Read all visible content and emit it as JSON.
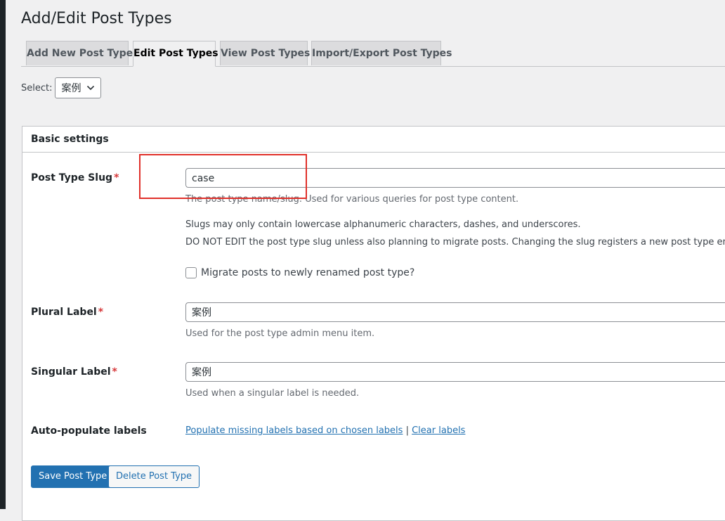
{
  "page": {
    "title": "Add/Edit Post Types"
  },
  "tabs": [
    {
      "label": "Add New Post Type",
      "active": false
    },
    {
      "label": "Edit Post Types",
      "active": true
    },
    {
      "label": "View Post Types",
      "active": false
    },
    {
      "label": "Import/Export Post Types",
      "active": false
    }
  ],
  "selector": {
    "label": "Select:",
    "value": "案例",
    "icon": "chevron-down-icon"
  },
  "panel": {
    "title": "Basic settings",
    "required_marker": "*",
    "slug": {
      "label": "Post Type Slug",
      "value": "case",
      "desc_1": "The post type name/slug. Used for various queries for post type content.",
      "desc_2": "Slugs may only contain lowercase alphanumeric characters, dashes, and underscores.",
      "desc_3": "DO NOT EDIT the post type slug unless also planning to migrate posts. Changing the slug registers a new post type entry.",
      "migrate_label": "Migrate posts to newly renamed post type?",
      "migrate_checked": false
    },
    "plural": {
      "label": "Plural Label",
      "value": "案例",
      "desc": "Used for the post type admin menu item."
    },
    "singular": {
      "label": "Singular Label",
      "value": "案例",
      "desc": "Used when a singular label is needed."
    },
    "auto_populate": {
      "label": "Auto-populate labels",
      "populate_link": "Populate missing labels based on chosen labels",
      "separator": "|",
      "clear_link": "Clear labels"
    },
    "buttons": {
      "save": "Save Post Type",
      "delete": "Delete Post Type"
    }
  },
  "colors": {
    "accent": "#2271b1",
    "required": "#d63638",
    "highlight": "#e0302a"
  }
}
